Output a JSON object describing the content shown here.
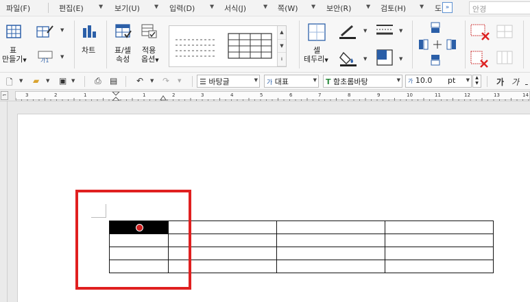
{
  "menu": {
    "items": [
      "파일(F)",
      "편집(E)",
      "보기(U)",
      "입력(D)",
      "서식(J)",
      "쪽(W)",
      "보안(R)",
      "검토(H)",
      "도"
    ],
    "more_glyph": "»",
    "search_placeholder": "안경"
  },
  "ribbon": {
    "table_label_1": "표",
    "table_label_2": "만들기",
    "format_label": "가1",
    "chart_label": "차트",
    "props_label_1": "표/셀",
    "props_label_2": "속성",
    "apply_label_1": "적용",
    "apply_label_2": "옵션",
    "cell_label_1": "셀",
    "cell_label_2": "테두리"
  },
  "formatbar": {
    "style_value": "바탕글",
    "style_icon": "☰",
    "outline_value": "대표",
    "outline_icon": "가",
    "font_value": "함초롬바탕",
    "font_icon": "T",
    "size_value": "10.0",
    "size_unit": "pt",
    "size_icon": "가",
    "bold_label": "가",
    "italic_label": "가"
  },
  "ruler": {
    "numbers": [
      "3",
      "2",
      "1",
      "1",
      "2",
      "3",
      "4",
      "5",
      "6",
      "7",
      "8",
      "9",
      "10",
      "11",
      "12",
      "13",
      "14"
    ],
    "corner_glyph": "⌐"
  },
  "colors": {
    "highlight": "#e02020",
    "selected_cell": "#000000",
    "cursor": "#d02020"
  }
}
